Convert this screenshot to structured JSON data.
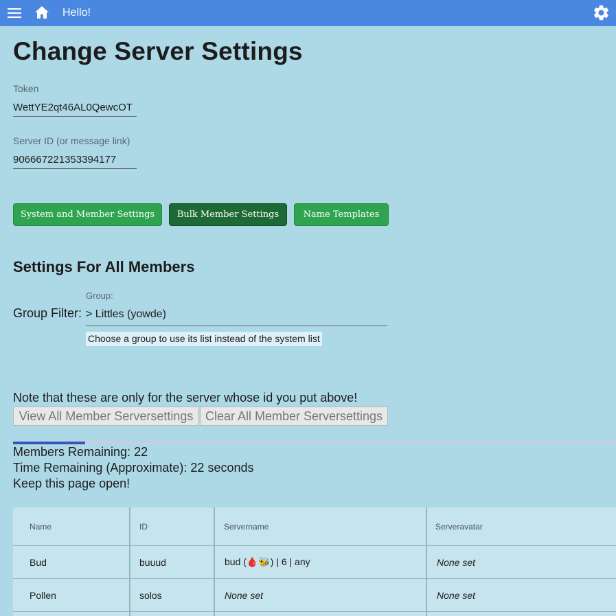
{
  "app": {
    "greeting": "Hello!",
    "icons": {
      "menu": "menu-icon",
      "home": "home-icon",
      "settings": "gear-icon"
    },
    "colors": {
      "topbar": "#4a87e0",
      "background": "#add8e6",
      "button_green": "#2ea44f",
      "button_active": "#1d6a36",
      "progress": "#3f51b5"
    }
  },
  "page": {
    "title": "Change Server Settings"
  },
  "form": {
    "token_label": "Token",
    "token_value": "WettYE2qt46AL0QewcOT",
    "server_label": "Server ID (or message link)",
    "server_value": "906667221353394177"
  },
  "tabs": [
    {
      "label": "System and Member Settings",
      "active": false
    },
    {
      "label": "Bulk Member Settings",
      "active": true
    },
    {
      "label": "Name Templates",
      "active": false
    }
  ],
  "section": {
    "title": "Settings For All Members",
    "group_filter_label": "Group Filter:",
    "group_label": "Group:",
    "group_value": "> Littles (yowde)",
    "group_tooltip": "Choose a group to use its list instead of the system list"
  },
  "actions": {
    "note": "Note that these are only for the server whose id you put above!",
    "view_all": "View All Member Serversettings",
    "clear_all": "Clear All Member Serversettings"
  },
  "progress": {
    "fraction": 0.12,
    "members_remaining": "Members Remaining: 22",
    "time_remaining": "Time Remaining (Approximate): 22 seconds",
    "keep_open": "Keep this page open!"
  },
  "table": {
    "headers": [
      "Name",
      "ID",
      "Servername",
      "Serveravatar"
    ],
    "rows": [
      {
        "name": "Bud",
        "id": "buuud",
        "servername": "bud (🩸🐝) | 6 | any",
        "serveravatar": "None set"
      },
      {
        "name": "Pollen",
        "id": "solos",
        "servername": "None set",
        "serveravatar": "None set"
      }
    ]
  }
}
